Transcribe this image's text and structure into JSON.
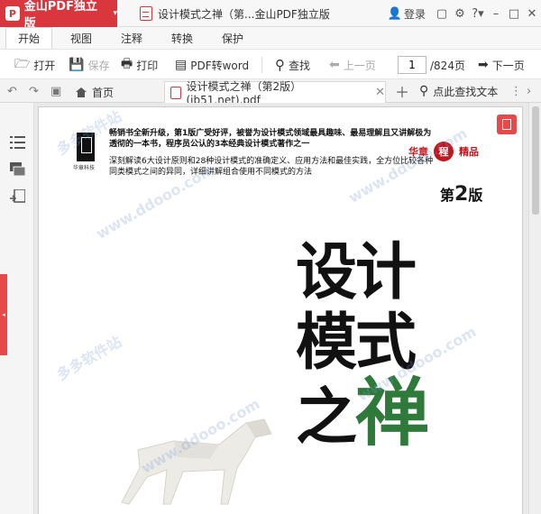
{
  "app": {
    "name": "金山PDF独立版",
    "window_title": "设计模式之禅（第...金山PDF独立版",
    "login_label": "登录"
  },
  "menu": {
    "tabs": [
      "开始",
      "视图",
      "注释",
      "转换",
      "保护"
    ]
  },
  "toolbar": {
    "open": "打开",
    "save": "保存",
    "print": "打印",
    "pdf_to_word": "PDF转word",
    "find": "查找",
    "prev_page": "上一页",
    "next_page": "下一页",
    "page_current": "1",
    "page_total": "/824页"
  },
  "tabs": {
    "home": "首页",
    "document": "设计模式之禅（第2版）(jb51.net).pdf",
    "search_text": "点此查找文本"
  },
  "cover": {
    "publisher": "华章科技",
    "line1": "畅销书全新升级，第1版广受好评，被誉为设计模式领域最具趣味、最易理解且又讲解极为透彻的一本书，程序员公认的3本经典设计模式著作之一",
    "line2": "深刻解读6大设计原则和28种设计模式的准确定义、应用方法和最佳实践，全方位比较各种同类模式之间的异同，详细讲解组合使用不同模式的方法",
    "series_left": "华章",
    "series_seal": "程",
    "series_right": "精品",
    "edition_prefix": "第",
    "edition_num": "2",
    "edition_suffix": "版",
    "title_row1": "设计",
    "title_row2": "模式",
    "title_row3_black": "之",
    "title_row3_green": "禅"
  },
  "watermark": {
    "site_cn": "多多软件站",
    "site_url": "www.ddooo.com"
  }
}
